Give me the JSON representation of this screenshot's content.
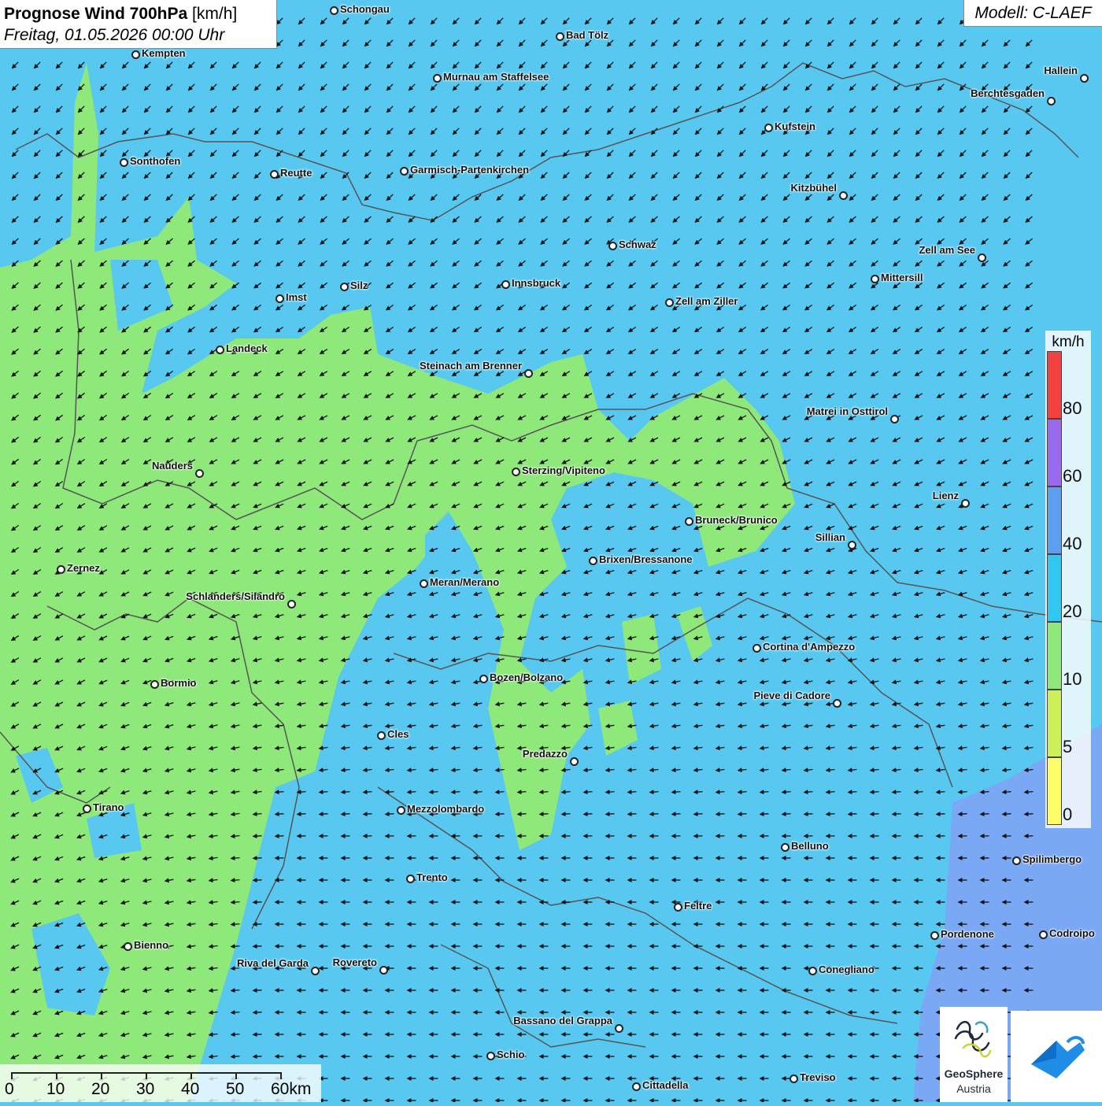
{
  "header": {
    "title_main": "Prognose Wind 700hPa",
    "title_unit": "[km/h]",
    "datetime": "Freitag, 01.05.2026 00:00 Uhr",
    "model": "Modell: C-LAEF"
  },
  "legend": {
    "unit": "km/h",
    "bands": [
      {
        "label": "0",
        "color": "#ffff66"
      },
      {
        "label": "5",
        "color": "#ccf05a"
      },
      {
        "label": "10",
        "color": "#8ee87a"
      },
      {
        "label": "20",
        "color": "#30c8f0"
      },
      {
        "label": "40",
        "color": "#5c9ef0"
      },
      {
        "label": "60",
        "color": "#9a6aee"
      },
      {
        "label": "80",
        "color": "#f44040"
      }
    ]
  },
  "scale_bar": {
    "labels": [
      "0",
      "10",
      "20",
      "30",
      "40",
      "50",
      "60km"
    ]
  },
  "colors": {
    "calm_green": "#8ee87a",
    "wind_blue": "#58c8f0",
    "strong_blue": "#7aa8f4",
    "border_line": "#555555"
  },
  "cities": [
    {
      "name": "Schongau"
    },
    {
      "name": "Bad Tölz"
    },
    {
      "name": "Kempten"
    },
    {
      "name": "Murnau am Staffelsee"
    },
    {
      "name": "Hallein"
    },
    {
      "name": "Berchtesgaden"
    },
    {
      "name": "Kufstein"
    },
    {
      "name": "Sonthofen"
    },
    {
      "name": "Reutte"
    },
    {
      "name": "Garmisch-Partenkirchen"
    },
    {
      "name": "Kitzbühel"
    },
    {
      "name": "Schwaz"
    },
    {
      "name": "Zell am See"
    },
    {
      "name": "Mittersill"
    },
    {
      "name": "Imst"
    },
    {
      "name": "Silz"
    },
    {
      "name": "Innsbruck"
    },
    {
      "name": "Zell am Ziller"
    },
    {
      "name": "Landeck"
    },
    {
      "name": "Steinach am Brenner"
    },
    {
      "name": "Matrei in Osttirol"
    },
    {
      "name": "Nauders"
    },
    {
      "name": "Sterzing/Vipiteno"
    },
    {
      "name": "Lienz"
    },
    {
      "name": "Bruneck/Brunico"
    },
    {
      "name": "Sillian"
    },
    {
      "name": "Zernez"
    },
    {
      "name": "Brixen/Bressanone"
    },
    {
      "name": "Meran/Merano"
    },
    {
      "name": "Schlanders/Silandro"
    },
    {
      "name": "Cortina d'Ampezzo"
    },
    {
      "name": "Bormio"
    },
    {
      "name": "Bozen/Bolzano"
    },
    {
      "name": "Pieve di Cadore"
    },
    {
      "name": "Cles"
    },
    {
      "name": "Predazzo"
    },
    {
      "name": "Tirano"
    },
    {
      "name": "Mezzolombardo"
    },
    {
      "name": "Belluno"
    },
    {
      "name": "Spilimbergo"
    },
    {
      "name": "Trento"
    },
    {
      "name": "Feltre"
    },
    {
      "name": "Bienno"
    },
    {
      "name": "Pordenone"
    },
    {
      "name": "Codroipo"
    },
    {
      "name": "Riva del Garda"
    },
    {
      "name": "Rovereto"
    },
    {
      "name": "Conegliano"
    },
    {
      "name": "Bassano del Grappa"
    },
    {
      "name": "Schio"
    },
    {
      "name": "Treviso"
    },
    {
      "name": "Cittadella"
    }
  ],
  "logos": {
    "geosphere_name": "GeoSphere",
    "geosphere_sub": "Austria"
  }
}
